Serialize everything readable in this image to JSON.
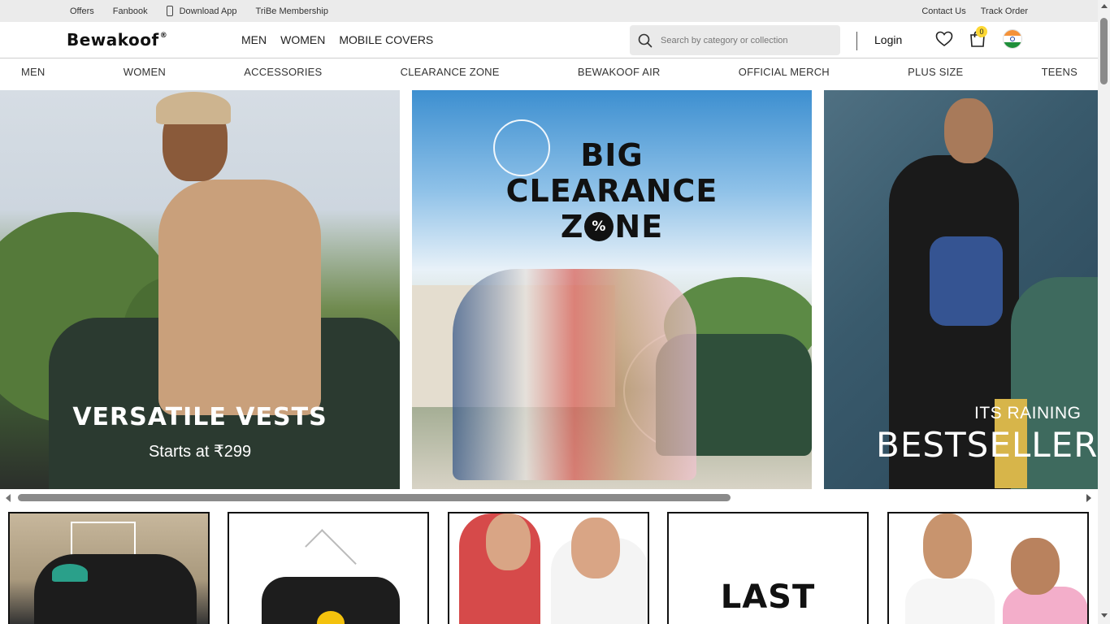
{
  "topbar": {
    "left": [
      "Offers",
      "Fanbook",
      "Download App",
      "TriBe Membership"
    ],
    "right": [
      "Contact Us",
      "Track Order"
    ]
  },
  "header": {
    "logo": "Bewakoof",
    "logo_mark": "®",
    "nav": [
      "MEN",
      "WOMEN",
      "MOBILE COVERS"
    ],
    "search_placeholder": "Search by category or collection",
    "login": "Login",
    "cart_count": "0",
    "icons": {
      "search": "search-icon",
      "wishlist": "heart-icon",
      "cart": "bag-icon",
      "country": "india-flag-icon"
    }
  },
  "categories": [
    "MEN",
    "WOMEN",
    "ACCESSORIES",
    "CLEARANCE ZONE",
    "BEWAKOOF AIR",
    "OFFICIAL MERCH",
    "PLUS SIZE",
    "TEENS"
  ],
  "banners": [
    {
      "title": "VERSATILE VESTS",
      "subtitle": "Starts at ₹299"
    },
    {
      "line1": "BIG",
      "line2": "CLEARANCE",
      "line3": "ZONE",
      "badge": "%"
    },
    {
      "line1": "ITS RAINING",
      "line2": "BESTSELLERS"
    }
  ],
  "tiles": [
    {
      "text": ""
    },
    {
      "text": ""
    },
    {
      "text": ""
    },
    {
      "text": "LAST"
    },
    {
      "text": ""
    }
  ],
  "colors": {
    "accent": "#fdd835",
    "topbar_bg": "#ebebeb",
    "search_bg": "#eaeaea"
  }
}
